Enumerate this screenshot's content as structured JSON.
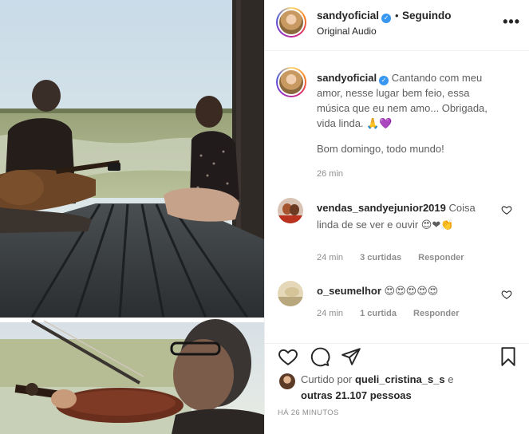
{
  "post": {
    "username": "sandyoficial",
    "follow_separator": "•",
    "follow_status": "Seguindo",
    "audio": "Original Audio",
    "more_label": "•••"
  },
  "caption": {
    "username": "sandyoficial",
    "text": "Cantando com meu amor, nesse lugar bem feio, essa música que eu nem amo... Obrigada, vida linda. 🙏💜",
    "line2": "Bom domingo, todo mundo!",
    "time": "26 min"
  },
  "comments": [
    {
      "username": "vendas_sandyejunior2019",
      "text": "Coisa linda de se ver e ouvir 😍❤👏",
      "time": "24 min",
      "likes": "3 curtidas",
      "reply": "Responder"
    },
    {
      "username": "o_seumelhor",
      "text": "😍😍😍😍😍",
      "time": "24 min",
      "likes": "1 curtida",
      "reply": "Responder"
    }
  ],
  "likes": {
    "prefix": "Curtido por",
    "user": "queli_cristina_s_s",
    "conj": "e",
    "others": "outras 21.107 pessoas"
  },
  "posted_ago": "HÁ 26 MINUTOS",
  "icons": {
    "like": "heart-icon",
    "comment": "comment-icon",
    "share": "paper-plane-icon",
    "save": "bookmark-icon",
    "verified": "verified-badge-icon"
  },
  "colors": {
    "verified": "#3897f0",
    "text": "#262626",
    "muted": "#8e8e8e"
  }
}
